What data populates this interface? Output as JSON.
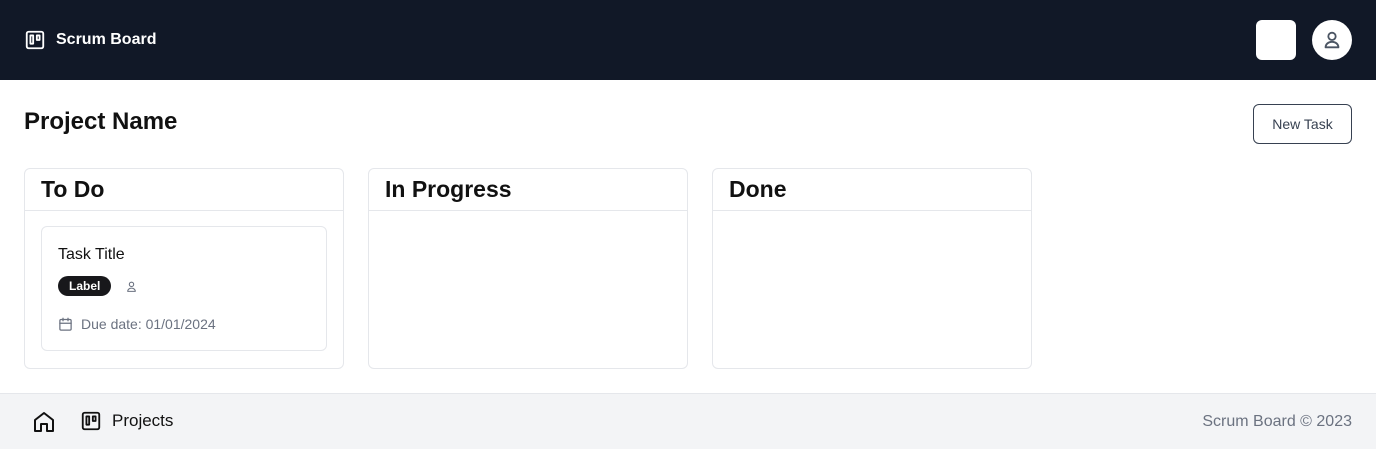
{
  "header": {
    "brand_icon": "board-icon",
    "brand_name": "Scrum Board",
    "avatar_icon": "user-icon",
    "background": "#111827"
  },
  "page": {
    "title": "Project Name",
    "new_task_label": "New Task"
  },
  "columns": [
    {
      "title": "To Do",
      "cards": [
        {
          "title": "Task Title",
          "label": "Label",
          "assignee_icon": "user-icon",
          "due_icon": "calendar-icon",
          "due_text": "Due date: 01/01/2024"
        }
      ]
    },
    {
      "title": "In Progress",
      "cards": []
    },
    {
      "title": "Done",
      "cards": []
    }
  ],
  "footer": {
    "home_icon": "home-icon",
    "projects_icon": "board-icon",
    "projects_label": "Projects",
    "copyright": "Scrum Board © 2023"
  },
  "colors": {
    "header_bg": "#111827",
    "footer_bg": "#f3f4f6",
    "badge_bg": "#18181b",
    "border": "#e5e7eb"
  }
}
